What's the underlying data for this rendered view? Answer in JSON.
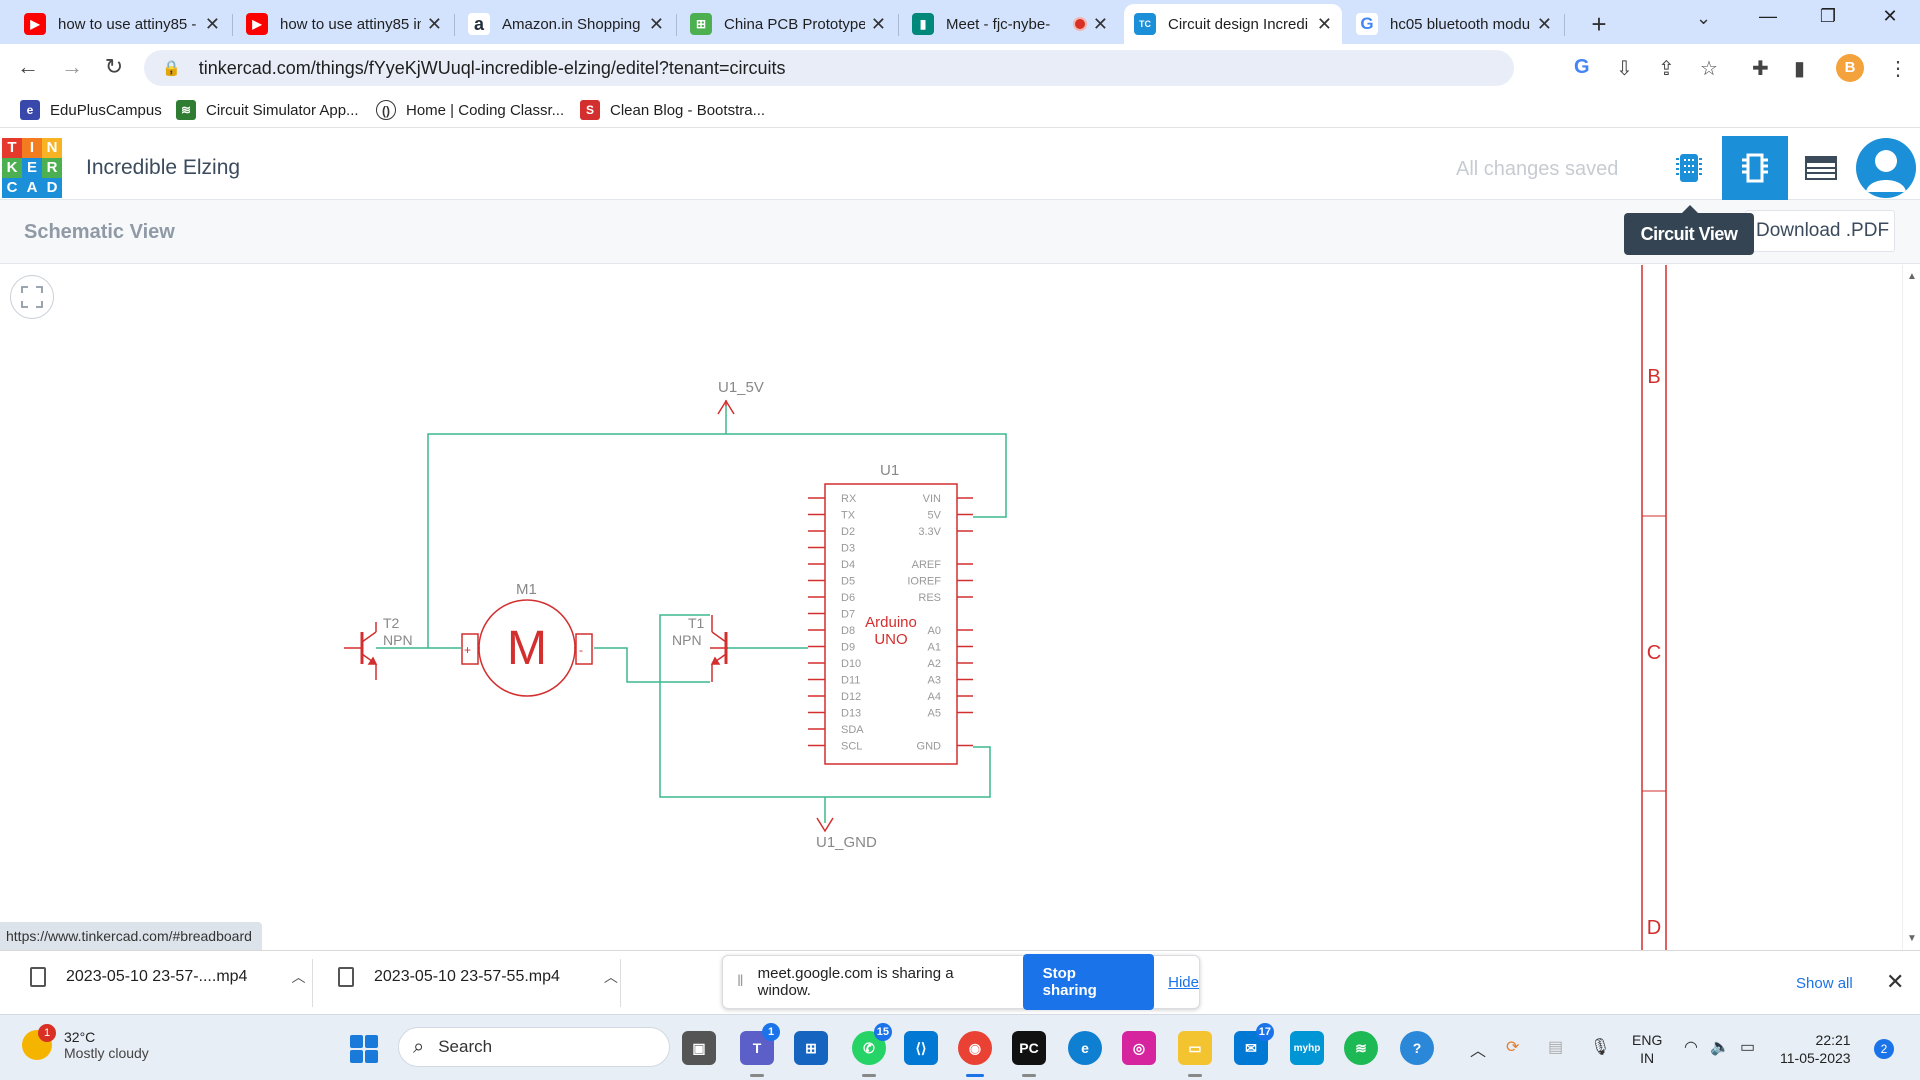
{
  "browser": {
    "tabs": [
      {
        "title": "how to use attiny85 -",
        "favicon": "youtube-icon",
        "color": "#ff0000"
      },
      {
        "title": "how to use attiny85 in",
        "favicon": "youtube-icon",
        "color": "#ff0000"
      },
      {
        "title": "Amazon.in Shopping",
        "favicon": "amazon-icon",
        "color": "#232f3e"
      },
      {
        "title": "China PCB Prototype",
        "favicon": "pcb-icon",
        "color": "#4caf50"
      },
      {
        "title": "Meet - fjc-nybe-",
        "favicon": "meet-icon",
        "color": "#00897b"
      },
      {
        "title": "Circuit design Incredi",
        "favicon": "tinkercad-icon",
        "color": "#1b8fd8"
      },
      {
        "title": "hc05 bluetooth modu",
        "favicon": "google-icon",
        "color": "#4285f4"
      }
    ],
    "new_tab_label": "+",
    "url": "tinkercad.com/things/fYyeKjWUuql-incredible-elzing/editel?tenant=circuits",
    "bookmarks": [
      {
        "label": "EduPlusCampus",
        "icon": "eduplus-icon",
        "color": "#3949ab"
      },
      {
        "label": "Circuit Simulator App...",
        "icon": "circuit-sim-icon",
        "color": "#2e7d32"
      },
      {
        "label": "Home | Coding Classr...",
        "icon": "coding-icon",
        "color": "#333333"
      },
      {
        "label": "Clean Blog - Bootstra...",
        "icon": "startbootstrap-icon",
        "color": "#d32f2f"
      }
    ],
    "profile_letter": "B",
    "status_url": "https://www.tinkercad.com/#breadboard"
  },
  "tinkercad": {
    "logo_letters": [
      "T",
      "I",
      "N",
      "K",
      "E",
      "R",
      "C",
      "A",
      "D"
    ],
    "logo_colors": [
      "#e5392b",
      "#f47c20",
      "#f7b323",
      "#e5392b",
      "#1b8fd8",
      "#1b8fd8",
      "#1b8fd8",
      "#1b8fd8",
      "#1b8fd8"
    ],
    "design_title": "Incredible Elzing",
    "save_status": "All changes saved",
    "view_name": "Schematic View",
    "download_label": "Download .PDF",
    "tooltip": "Circuit View",
    "accent": "#1b8fd8"
  },
  "schematic": {
    "power_label": "U1_5V",
    "ground_label": "U1_GND",
    "arduino_ref": "U1",
    "arduino_name_1": "Arduino",
    "arduino_name_2": "UNO",
    "left_pins": [
      "RX",
      "TX",
      "D2",
      "D3",
      "D4",
      "D5",
      "D6",
      "D7",
      "D8",
      "D9",
      "D10",
      "D11",
      "D12",
      "D13",
      "SDA",
      "SCL"
    ],
    "right_pins": [
      "VIN",
      "5V",
      "3.3V",
      "",
      "AREF",
      "IOREF",
      "RES",
      "",
      "A0",
      "A1",
      "A2",
      "A3",
      "A4",
      "A5",
      "",
      "GND"
    ],
    "motor_ref": "M1",
    "motor_symbol": "M",
    "t2_ref": "T2",
    "t2_type": "NPN",
    "t1_ref": "T1",
    "t1_type": "NPN",
    "frame_labels": [
      "B",
      "C",
      "D"
    ],
    "wire_color": "#3cb98d",
    "part_color": "#d32f2f"
  },
  "downloads": {
    "items": [
      {
        "name": "2023-05-10 23-57-....mp4"
      },
      {
        "name": "2023-05-10 23-57-55.mp4"
      }
    ],
    "share_text": "meet.google.com is sharing a window.",
    "stop_sharing": "Stop sharing",
    "hide": "Hide",
    "show_all": "Show all"
  },
  "taskbar": {
    "weather_temp": "32°C",
    "weather_cond": "Mostly cloudy",
    "weather_badge": "1",
    "search_placeholder": "Search",
    "teams_badge": "1",
    "whatsapp_badge": "15",
    "mail_badge": "17",
    "lang_1": "ENG",
    "lang_2": "IN",
    "time": "22:21",
    "date": "11-05-2023",
    "notifications": "2"
  }
}
